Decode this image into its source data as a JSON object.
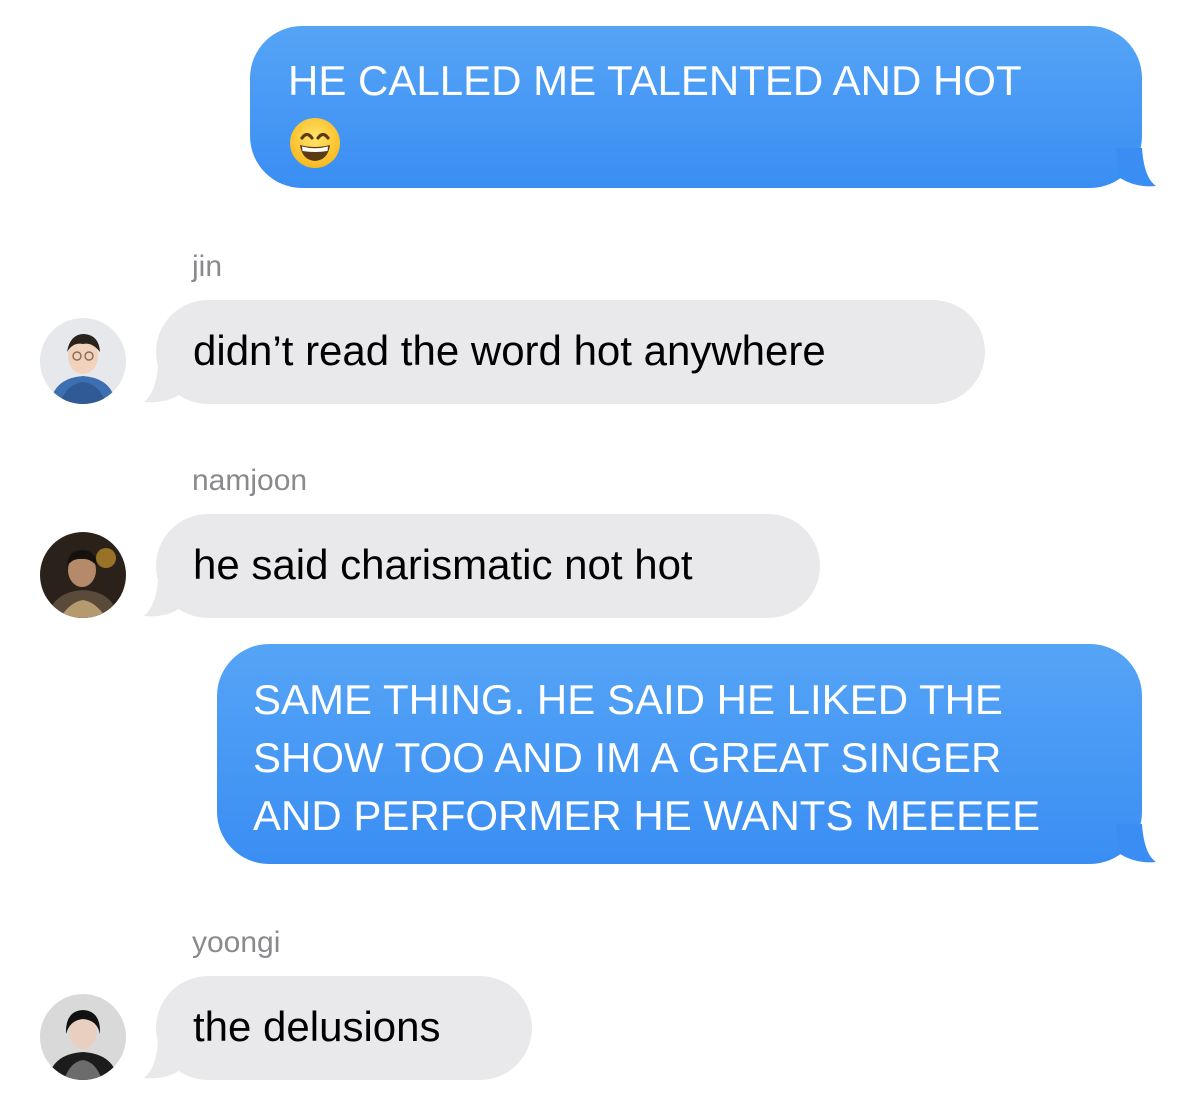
{
  "conversation": {
    "messages": [
      {
        "direction": "outgoing",
        "lines": [
          "HE CALLED ME TALENTED AND HOT"
        ],
        "emoji": "grinning-face-with-smiling-eyes"
      },
      {
        "direction": "incoming",
        "sender": "jin",
        "lines": [
          "didn’t read the word hot anywhere"
        ]
      },
      {
        "direction": "incoming",
        "sender": "namjoon",
        "lines": [
          "he said charismatic not hot"
        ]
      },
      {
        "direction": "outgoing",
        "lines": [
          "SAME THING.  HE SAID HE LIKED THE",
          "SHOW TOO AND IM A GREAT SINGER",
          "AND PERFORMER HE WANTS MEEEEE"
        ]
      },
      {
        "direction": "incoming",
        "sender": "yoongi",
        "lines": [
          "the delusions"
        ]
      }
    ]
  },
  "colors": {
    "outgoing_bubble": "#3a8ef3",
    "incoming_bubble": "#e9e9eb",
    "sender_name": "#8a8a8e"
  }
}
